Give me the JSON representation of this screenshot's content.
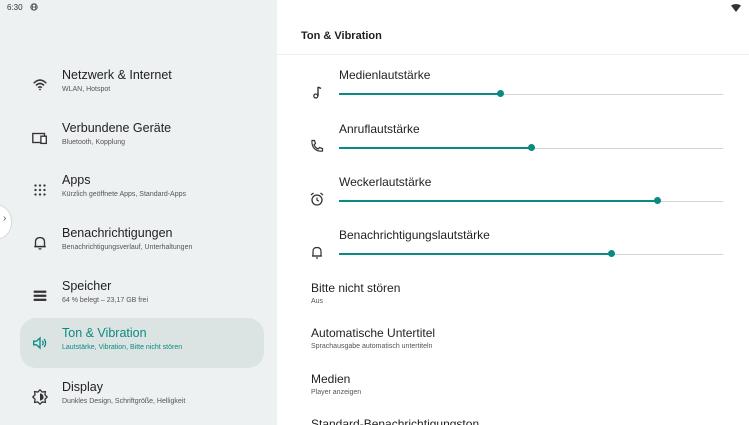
{
  "status_bar": {
    "time": "6:30"
  },
  "sidebar": {
    "items": [
      {
        "title": "Netzwerk & Internet",
        "subtitle": "WLAN, Hotspot",
        "icon": "wifi-icon",
        "active": false
      },
      {
        "title": "Verbundene Geräte",
        "subtitle": "Bluetooth, Kopplung",
        "icon": "connected-devices-icon",
        "active": false
      },
      {
        "title": "Apps",
        "subtitle": "Kürzlich geöffnete Apps, Standard-Apps",
        "icon": "apps-grid-icon",
        "active": false
      },
      {
        "title": "Benachrichtigungen",
        "subtitle": "Benachrichtigungsverlauf, Unterhaltungen",
        "icon": "bell-icon",
        "active": false
      },
      {
        "title": "Speicher",
        "subtitle": "64 % belegt – 23,17 GB frei",
        "icon": "storage-icon",
        "active": false
      },
      {
        "title": "Ton & Vibration",
        "subtitle": "Lautstärke, Vibration, Bitte nicht stören",
        "icon": "volume-icon",
        "active": true
      },
      {
        "title": "Display",
        "subtitle": "Dunkles Design, Schriftgröße, Helligkeit",
        "icon": "brightness-icon",
        "active": false
      }
    ]
  },
  "main": {
    "page_title": "Ton & Vibration",
    "sliders": [
      {
        "label": "Medienlautstärke",
        "icon": "music-note-icon",
        "level": 0.42
      },
      {
        "label": "Anruflautstärke",
        "icon": "phone-icon",
        "level": 0.5
      },
      {
        "label": "Weckerlautstärke",
        "icon": "alarm-icon",
        "level": 0.83
      },
      {
        "label": "Benachrichtigungslautstärke",
        "icon": "bell-icon",
        "level": 0.71
      }
    ],
    "settings": [
      {
        "title": "Bitte nicht stören",
        "subtitle": "Aus"
      },
      {
        "title": "Automatische Untertitel",
        "subtitle": "Sprachausgabe automatisch untertiteln"
      },
      {
        "title": "Medien",
        "subtitle": "Player anzeigen"
      },
      {
        "title": "Standard-Benachrichtigungston",
        "subtitle": ""
      }
    ]
  },
  "colors": {
    "accent": "#0a8a82",
    "sidebar_bg": "#eef1f1",
    "active_bg": "#dce4e3"
  }
}
